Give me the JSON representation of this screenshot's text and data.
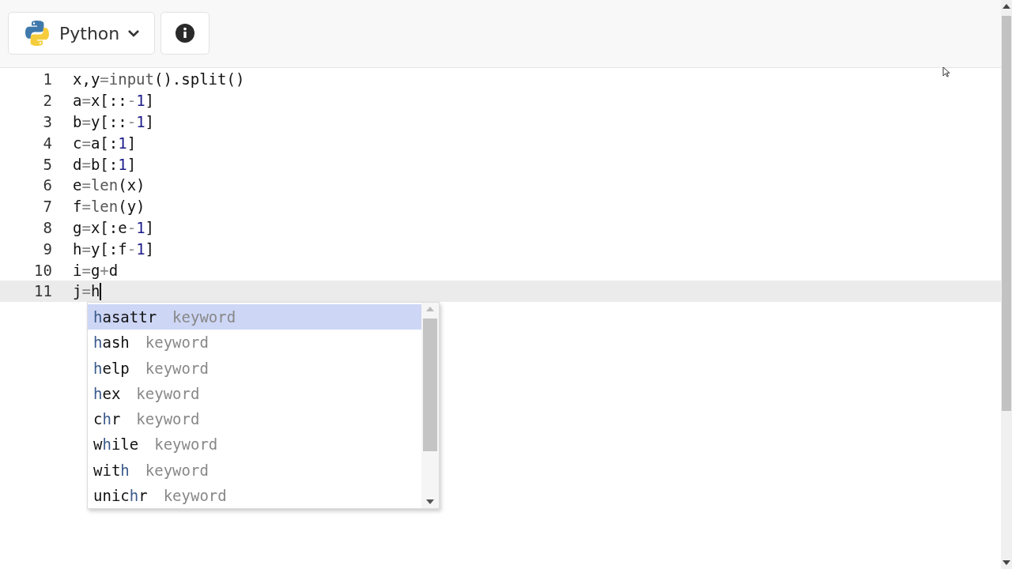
{
  "toolbar": {
    "language": "Python"
  },
  "editor": {
    "lines": [
      {
        "number": "1",
        "code": "x,y=input().split()",
        "active": false
      },
      {
        "number": "2",
        "code": "a=x[::-1]",
        "active": false
      },
      {
        "number": "3",
        "code": "b=y[::-1]",
        "active": false
      },
      {
        "number": "4",
        "code": "c=a[:1]",
        "active": false
      },
      {
        "number": "5",
        "code": "d=b[:1]",
        "active": false
      },
      {
        "number": "6",
        "code": "e=len(x)",
        "active": false
      },
      {
        "number": "7",
        "code": "f=len(y)",
        "active": false
      },
      {
        "number": "8",
        "code": "g=x[:e-1]",
        "active": false
      },
      {
        "number": "9",
        "code": "h=y[:f-1]",
        "active": false
      },
      {
        "number": "10",
        "code": "i=g+d",
        "active": false
      },
      {
        "number": "11",
        "code": "j=h",
        "active": true
      }
    ],
    "suggestions": [
      {
        "match": "h",
        "suffix": "asattr",
        "type": "keyword",
        "selected": true
      },
      {
        "match": "h",
        "suffix": "ash",
        "type": "keyword",
        "selected": false
      },
      {
        "match": "h",
        "suffix": "elp",
        "type": "keyword",
        "selected": false
      },
      {
        "match": "h",
        "suffix": "ex",
        "type": "keyword",
        "selected": false
      },
      {
        "prefix": "c",
        "match": "h",
        "suffix": "r",
        "type": "keyword",
        "selected": false
      },
      {
        "prefix": "w",
        "match": "h",
        "suffix": "ile",
        "type": "keyword",
        "selected": false
      },
      {
        "prefix": "wit",
        "match": "h",
        "type": "keyword",
        "selected": false
      },
      {
        "prefix": "unic",
        "match": "h",
        "suffix": "r",
        "type": "keyword",
        "selected": false
      }
    ]
  }
}
